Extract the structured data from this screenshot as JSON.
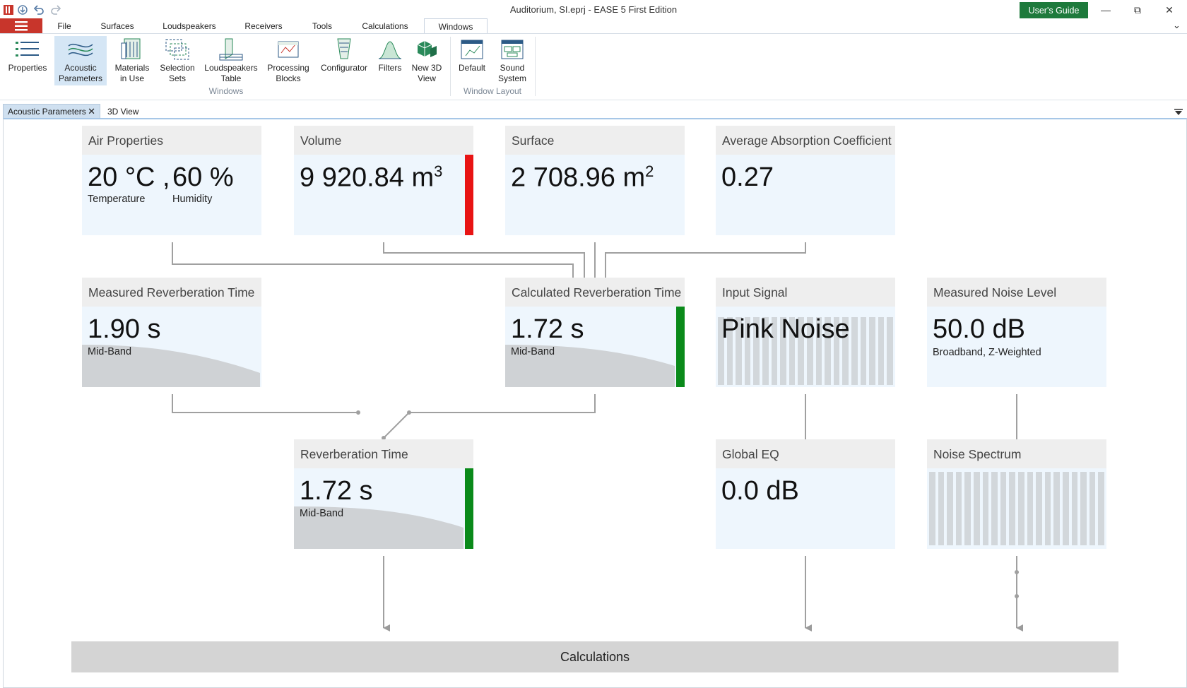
{
  "titlebar": {
    "title": "Auditorium, SI.eprj - EASE 5 First Edition",
    "guide_button": "User's Guide"
  },
  "menu": {
    "tabs": [
      "File",
      "Surfaces",
      "Loudspeakers",
      "Receivers",
      "Tools",
      "Calculations",
      "Windows"
    ],
    "active": "Windows"
  },
  "ribbon": {
    "buttons": [
      {
        "label": "Properties",
        "icon": "properties-icon"
      },
      {
        "label": "Acoustic\nParameters",
        "icon": "acoustic-parameters-icon",
        "active": true
      },
      {
        "label": "Materials\nin Use",
        "icon": "materials-icon"
      },
      {
        "label": "Selection\nSets",
        "icon": "selection-sets-icon"
      },
      {
        "label": "Loudspeakers\nTable",
        "icon": "loudspeakers-table-icon"
      },
      {
        "label": "Processing\nBlocks",
        "icon": "processing-blocks-icon"
      },
      {
        "label": "Configurator",
        "icon": "configurator-icon"
      },
      {
        "label": "Filters",
        "icon": "filters-icon"
      },
      {
        "label": "New 3D\nView",
        "icon": "3d-view-icon"
      },
      {
        "label": "Default",
        "icon": "default-layout-icon"
      },
      {
        "label": "Sound\nSystem",
        "icon": "sound-system-layout-icon"
      }
    ],
    "groups": [
      "Windows",
      "Window Layout"
    ]
  },
  "doctabs": {
    "active": "Acoustic Parameters",
    "other": "3D View"
  },
  "cards": {
    "air": {
      "title": "Air Properties",
      "temp": "20 °C ,",
      "hum": "60 %",
      "temp_label": "Temperature",
      "hum_label": "Humidity"
    },
    "volume": {
      "title": "Volume",
      "value": "9 920.84 m",
      "sup": "3",
      "status_color": "#e81414"
    },
    "surface": {
      "title": "Surface",
      "value": "2 708.96 m",
      "sup": "2"
    },
    "absorption": {
      "title": "Average Absorption Coefficient",
      "value": "0.27"
    },
    "measured_rt": {
      "title": "Measured Reverberation Time",
      "value": "1.90  s",
      "sub": "Mid-Band"
    },
    "calc_rt": {
      "title": "Calculated Reverberation Time",
      "value": "1.72  s",
      "sub": "Mid-Band",
      "status_color": "#0a8a1a"
    },
    "input_signal": {
      "title": "Input Signal",
      "value": "Pink Noise"
    },
    "noise_level": {
      "title": "Measured Noise Level",
      "value": "50.0  dB",
      "sub": "Broadband, Z-Weighted"
    },
    "rt": {
      "title": "Reverberation Time",
      "value": "1.72  s",
      "sub": "Mid-Band",
      "status_color": "#0a8a1a"
    },
    "global_eq": {
      "title": "Global EQ",
      "value": "0.0  dB"
    },
    "noise_spectrum": {
      "title": "Noise Spectrum"
    }
  },
  "calculations_label": "Calculations"
}
